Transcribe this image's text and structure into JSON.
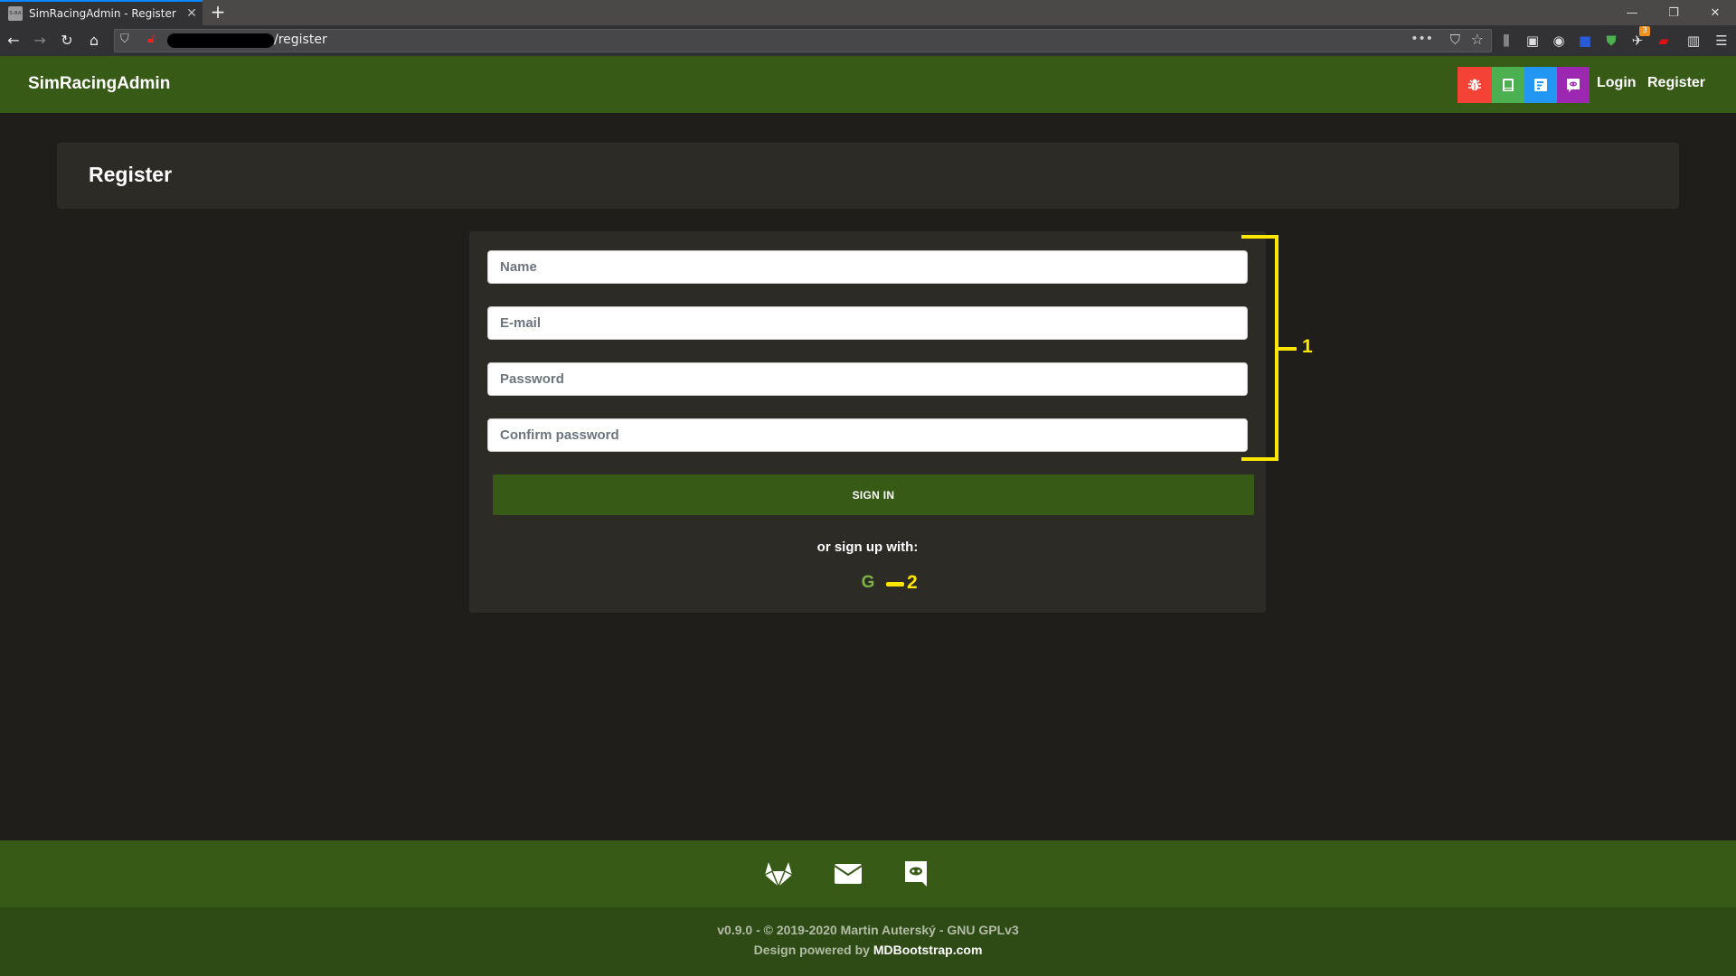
{
  "browser": {
    "tab_title": "SimRacingAdmin - Register",
    "favicon_text": "S-RA",
    "url_visible_suffix": "/register",
    "extension_badge": "3"
  },
  "navbar": {
    "brand": "SimRacingAdmin",
    "icon_buttons": [
      {
        "name": "bug-icon",
        "color": "#f44336"
      },
      {
        "name": "book-icon",
        "color": "#4caf50"
      },
      {
        "name": "document-icon",
        "color": "#2196f3"
      },
      {
        "name": "discord-icon",
        "color": "#9c27b0"
      }
    ],
    "login_label": "Login",
    "register_label": "Register"
  },
  "page": {
    "title": "Register"
  },
  "form": {
    "name_placeholder": "Name",
    "email_placeholder": "E-mail",
    "password_placeholder": "Password",
    "confirm_placeholder": "Confirm password",
    "submit_label": "SIGN IN",
    "alt_text": "or sign up with:",
    "google_glyph": "G"
  },
  "annotations": {
    "label_1": "1",
    "label_2": "2"
  },
  "footer": {
    "icons": [
      "gitlab-icon",
      "envelope-icon",
      "discord-icon"
    ],
    "copyright": "v0.9.0 - © 2019-2020 Martin Auterský - GNU GPLv3",
    "powered_prefix": "Design powered by ",
    "powered_link": "MDBootstrap.com"
  },
  "colors": {
    "brand_green": "#375a16",
    "footer_dark": "#2e4a15",
    "background": "#1f1e1a",
    "card": "#2c2b26",
    "google_green": "#7cb342",
    "annotation_yellow": "#ffe600"
  }
}
